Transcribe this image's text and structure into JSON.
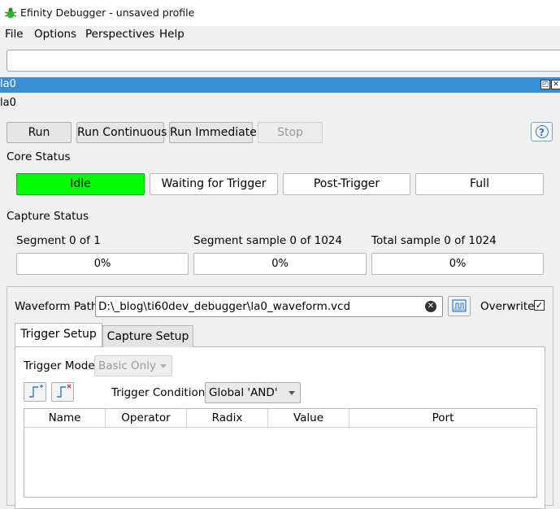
{
  "window": {
    "title": "Efinity Debugger - unsaved profile",
    "icon": "bug-icon"
  },
  "menu": [
    "File",
    "Options",
    "Perspectives",
    "Help"
  ],
  "address_bar": {
    "value": ""
  },
  "tab_bar": {
    "label": "la0",
    "buttons": [
      "restore-icon",
      "close-icon"
    ]
  },
  "sub_label": "la0",
  "toolbar": {
    "run": "Run",
    "run_continuous": "Run Continuous",
    "run_immediate": "Run Immediate",
    "stop": "Stop",
    "help": "?"
  },
  "core_status": {
    "heading": "Core Status",
    "states": [
      "Idle",
      "Waiting for Trigger",
      "Post-Trigger",
      "Full"
    ],
    "active": "Idle",
    "active_color": "#00ff00"
  },
  "capture_status": {
    "heading": "Capture Status",
    "segment_label": "Segment 0 of 1",
    "segment_progress": "0%",
    "segment_sample_label": "Segment sample 0 of 1024",
    "segment_sample_progress": "0%",
    "total_sample_label": "Total sample 0 of 1024",
    "total_sample_progress": "0%"
  },
  "waveform": {
    "label": "Waveform Path",
    "path": "D:\\_blog\\ti60dev_debugger\\la0_waveform.vcd",
    "overwrite_label": "Overwrite",
    "overwrite_checked": true
  },
  "tabs": [
    "Trigger Setup",
    "Capture Setup"
  ],
  "trigger": {
    "mode_label": "Trigger Mode",
    "mode_value": "Basic Only",
    "condition_label": "Trigger Condition",
    "condition_value": "Global 'AND'"
  },
  "table": {
    "columns": [
      "Name",
      "Operator",
      "Radix",
      "Value",
      "Port"
    ],
    "rows": []
  }
}
